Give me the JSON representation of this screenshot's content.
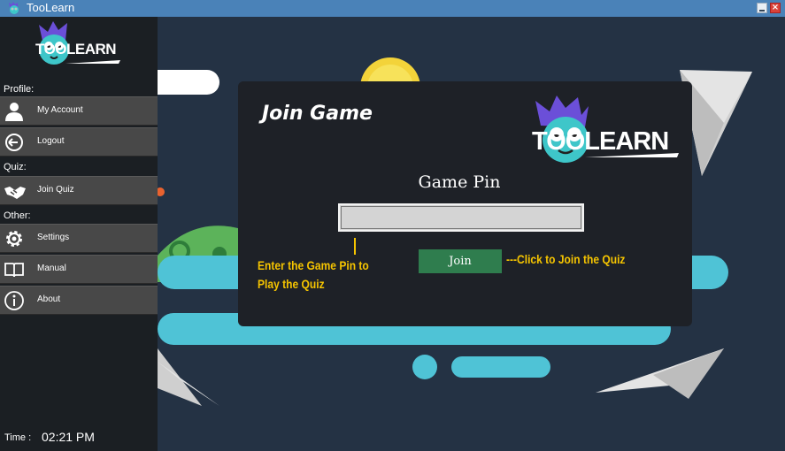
{
  "window": {
    "title": "TooLearn",
    "close_glyph": "×"
  },
  "sidebar": {
    "logo_text": "TOOLEARN",
    "sections": {
      "profile": "Profile:",
      "quiz": "Quiz:",
      "other": "Other:"
    },
    "items": [
      {
        "label": "My Account",
        "icon": "user-icon"
      },
      {
        "label": "Logout",
        "icon": "logout-icon"
      },
      {
        "label": "Join Quiz",
        "icon": "handshake-icon"
      },
      {
        "label": "Settings",
        "icon": "gear-icon"
      },
      {
        "label": "Manual",
        "icon": "book-icon"
      },
      {
        "label": "About",
        "icon": "info-icon"
      }
    ],
    "time_label": "Time :",
    "time_value": "02:21 PM"
  },
  "join_panel": {
    "title": "Join Game",
    "logo_text": "TOOLEARN",
    "pin_label": "Game Pin",
    "pin_value": "",
    "join_button": "Join",
    "hint_pin": "Enter the Game Pin to Play the Quiz",
    "hint_join": "---Click to Join the Quiz"
  },
  "colors": {
    "titlebar": "#4a82b8",
    "background": "#243244",
    "sidebar": "#1b1f23",
    "nav_item": "#484848",
    "panel": "#1e2127",
    "join_button": "#2f7d4e",
    "hint": "#f5c400",
    "logo_purple": "#6b4fd8",
    "logo_teal": "#3ec6c9"
  }
}
